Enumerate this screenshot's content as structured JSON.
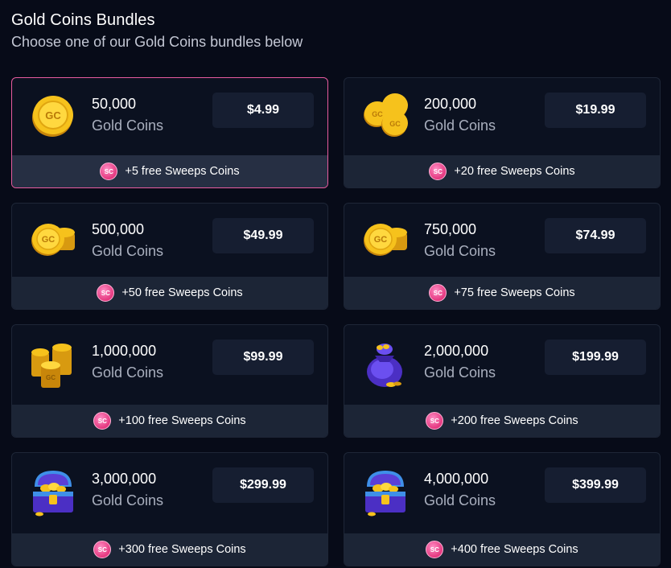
{
  "header": {
    "title": "Gold Coins Bundles",
    "subtitle": "Choose one of our Gold Coins bundles below"
  },
  "badge_text": "SC",
  "bundles": [
    {
      "amount": "50,000",
      "unit": "Gold Coins",
      "price": "$4.99",
      "bonus": "+5 free Sweeps Coins",
      "icon": "single-gold-coin-icon",
      "selected": true
    },
    {
      "amount": "200,000",
      "unit": "Gold Coins",
      "price": "$19.99",
      "bonus": "+20 free Sweeps Coins",
      "icon": "three-gold-coins-icon",
      "selected": false
    },
    {
      "amount": "500,000",
      "unit": "Gold Coins",
      "price": "$49.99",
      "bonus": "+50 free Sweeps Coins",
      "icon": "coin-stack-icon",
      "selected": false
    },
    {
      "amount": "750,000",
      "unit": "Gold Coins",
      "price": "$74.99",
      "bonus": "+75 free Sweeps Coins",
      "icon": "coin-stack-icon",
      "selected": false
    },
    {
      "amount": "1,000,000",
      "unit": "Gold Coins",
      "price": "$99.99",
      "bonus": "+100 free Sweeps Coins",
      "icon": "coin-towers-icon",
      "selected": false
    },
    {
      "amount": "2,000,000",
      "unit": "Gold Coins",
      "price": "$199.99",
      "bonus": "+200 free Sweeps Coins",
      "icon": "coin-bag-icon",
      "selected": false
    },
    {
      "amount": "3,000,000",
      "unit": "Gold Coins",
      "price": "$299.99",
      "bonus": "+300 free Sweeps Coins",
      "icon": "treasure-chest-icon",
      "selected": false
    },
    {
      "amount": "4,000,000",
      "unit": "Gold Coins",
      "price": "$399.99",
      "bonus": "+400 free Sweeps Coins",
      "icon": "treasure-chest-icon",
      "selected": false
    }
  ],
  "colors": {
    "background": "#070b18",
    "card": "#0b1120",
    "card_footer": "#1c2536",
    "price_button": "#161e31",
    "selected_border": "#e85b9f",
    "gold": "#f6c21c",
    "sweeps_pink": "#e4387f"
  }
}
